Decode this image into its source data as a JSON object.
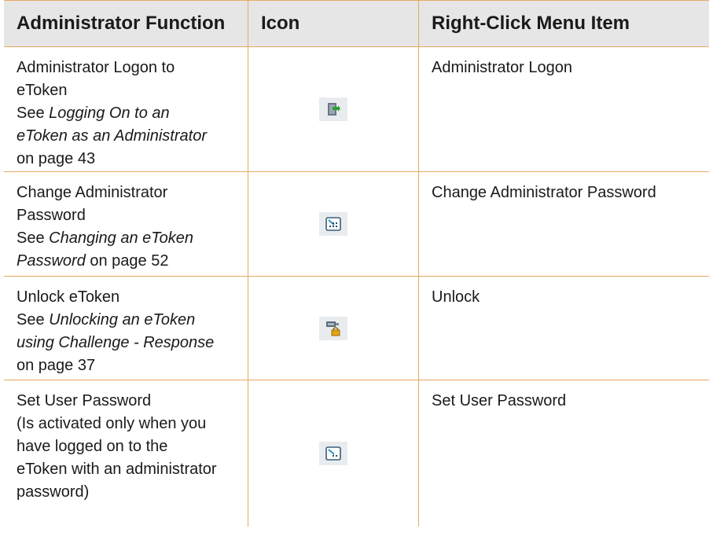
{
  "headers": {
    "function": "Administrator Function",
    "icon": "Icon",
    "menu_item": "Right-Click Menu Item"
  },
  "rows": [
    {
      "function_lines": [
        "Administrator Logon to",
        "eToken"
      ],
      "see_prefix": "See ",
      "ref_lines": [
        "Logging On to an",
        "eToken as an Administrator"
      ],
      "page_text": "on page 43",
      "icon": "administrator-logon-icon",
      "menu_item": "Administrator Logon"
    },
    {
      "function_lines": [
        "Change Administrator",
        "Password"
      ],
      "see_prefix": "See ",
      "ref_lines": [
        "Changing an eToken",
        "Password"
      ],
      "page_text": " on page 52",
      "icon": "change-password-icon",
      "menu_item": "Change Administrator Password"
    },
    {
      "function_lines": [
        "Unlock eToken"
      ],
      "see_prefix": "See ",
      "ref_lines": [
        "Unlocking an eToken",
        "using Challenge - Response"
      ],
      "page_text": "on page 37",
      "icon": "unlock-icon",
      "menu_item": "Unlock"
    },
    {
      "function_lines": [
        "Set User Password",
        "(Is activated only when you",
        "have logged on to the",
        "eToken with an administrator",
        "password)"
      ],
      "icon": "set-user-password-icon",
      "menu_item": "Set User Password"
    }
  ],
  "colors": {
    "rule": "#e8a860",
    "header_bg": "#e6e6e6"
  }
}
